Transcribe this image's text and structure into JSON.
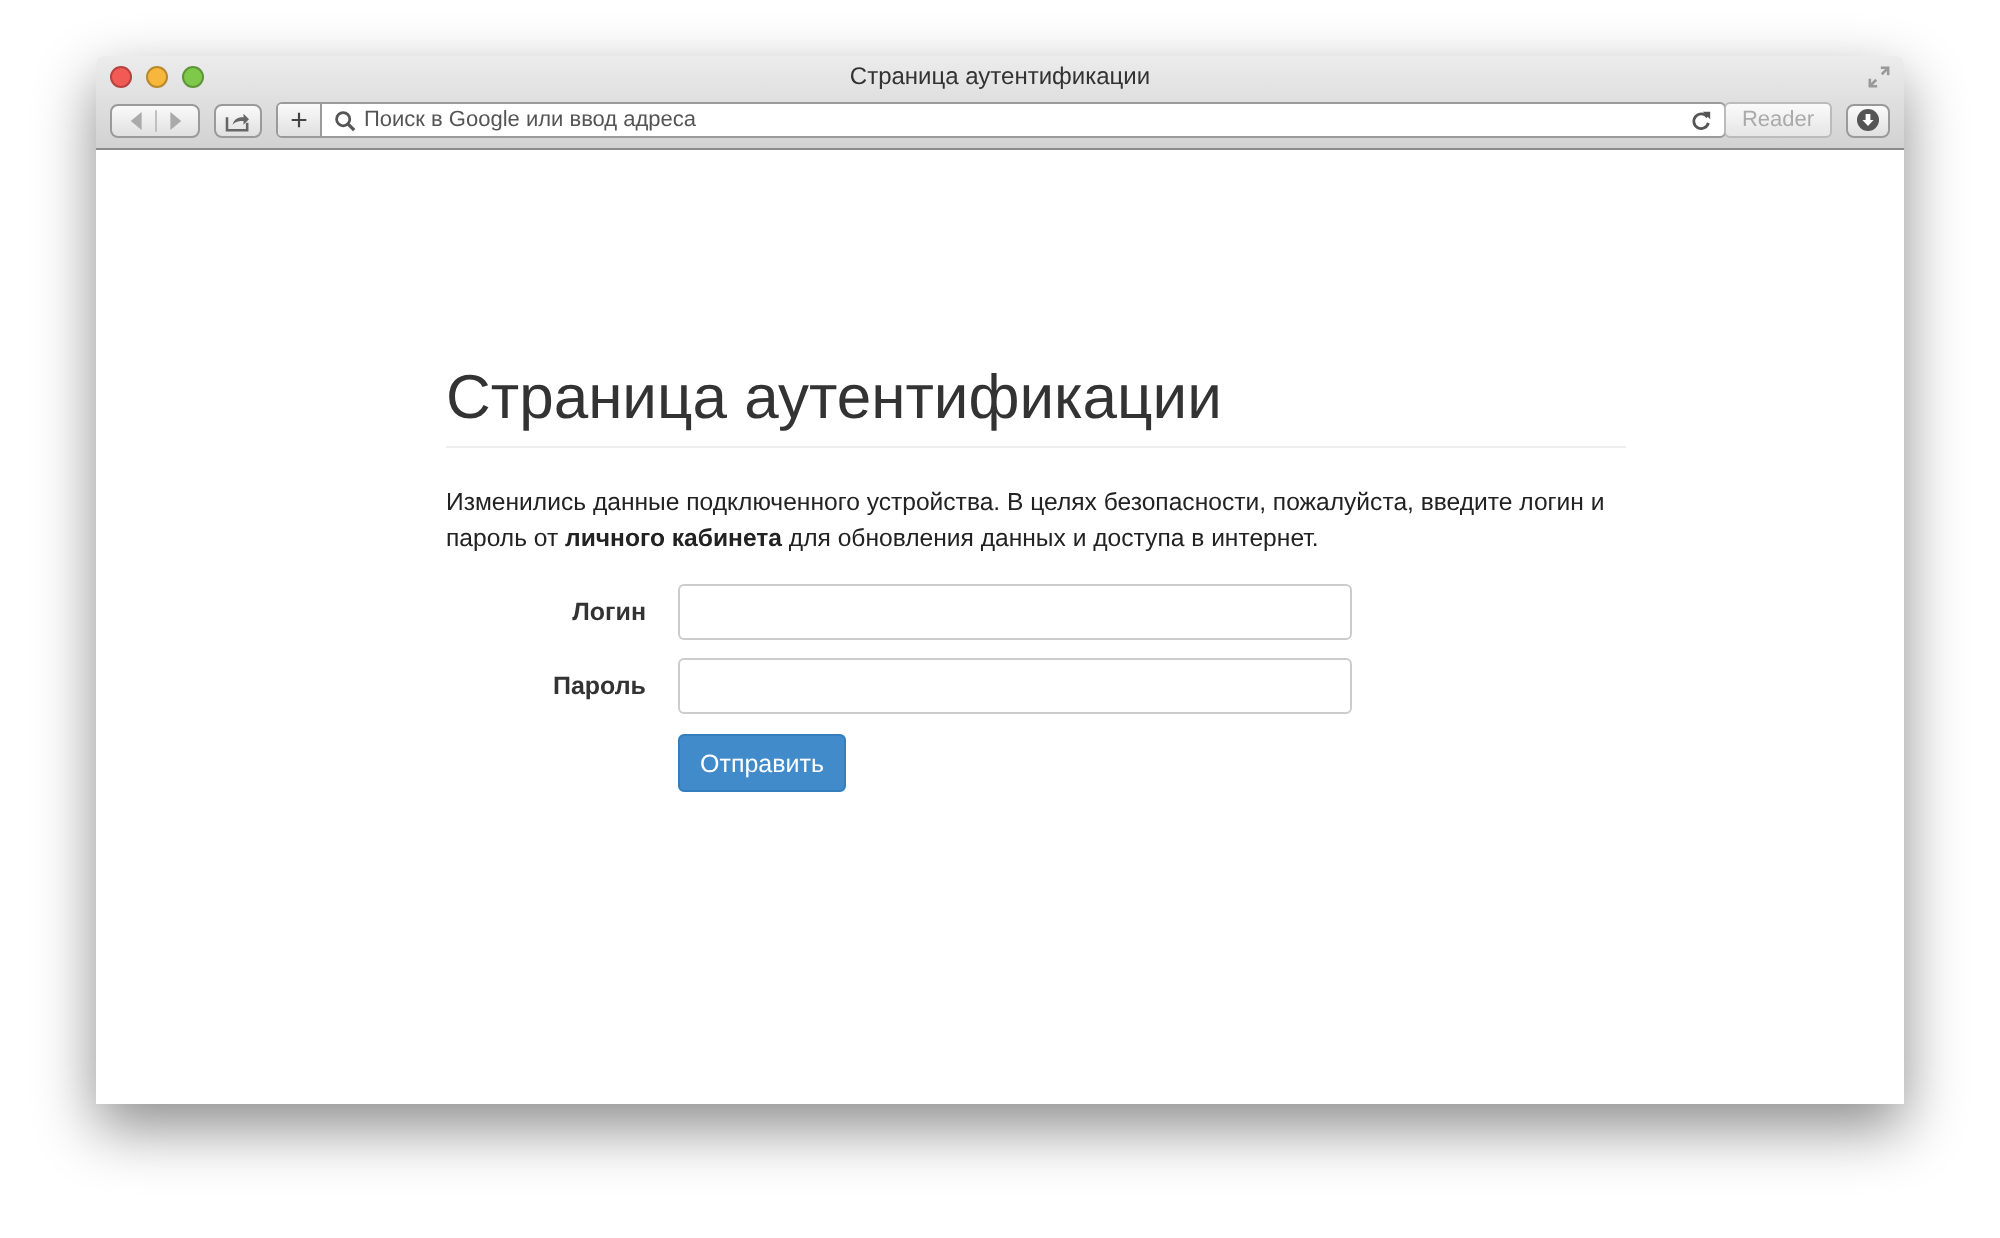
{
  "window": {
    "title": "Страница аутентификации"
  },
  "toolbar": {
    "address": {
      "placeholder": "Поиск в Google или ввод адреса"
    },
    "reader": {
      "label": "Reader",
      "disabled": true
    },
    "new_tab": "+"
  },
  "page": {
    "heading": "Страница аутентификации",
    "message": "Изменились данные подключенного устройства. В целях безопасности, пожалуйста, введите логин и пароль от **личного кабинета** для обновления данных и доступа в интернет.",
    "fields": [
      {
        "label": "Логин"
      },
      {
        "label": "Пароль"
      }
    ],
    "submit": "Отправить"
  }
}
